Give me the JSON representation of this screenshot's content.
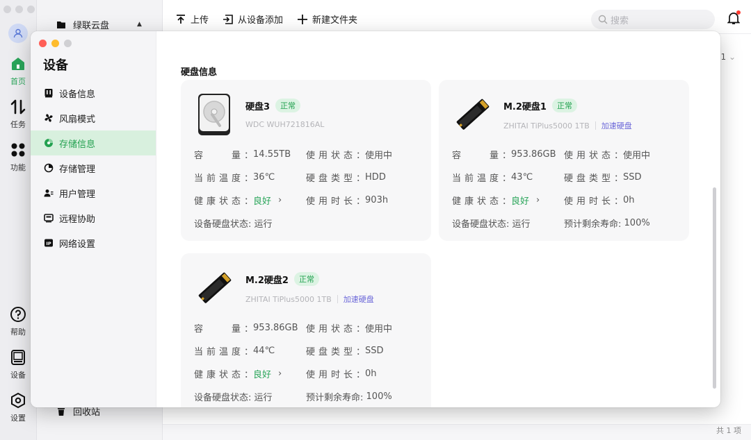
{
  "background": {
    "rail": {
      "items": [
        {
          "label": "首页",
          "icon": "home-icon",
          "active": true
        },
        {
          "label": "任务",
          "icon": "transfer-icon"
        },
        {
          "label": "功能",
          "icon": "apps-icon"
        },
        {
          "label": "帮助",
          "icon": "help-icon"
        },
        {
          "label": "设备",
          "icon": "device-icon"
        },
        {
          "label": "设置",
          "icon": "settings-icon"
        }
      ]
    },
    "sidebar": {
      "title": "绿联云盘",
      "trash": "回收站"
    },
    "toolbar": {
      "upload": "上传",
      "add_from_device": "从设备添加",
      "new_folder": "新建文件夹"
    },
    "search": {
      "placeholder": "搜索"
    },
    "partial_text": "1",
    "footer": "共 1 项"
  },
  "modal": {
    "title": "设备",
    "nav": [
      {
        "label": "设备信息",
        "icon": "device-info-icon"
      },
      {
        "label": "风扇模式",
        "icon": "fan-icon"
      },
      {
        "label": "存储信息",
        "icon": "storage-info-icon",
        "active": true
      },
      {
        "label": "存储管理",
        "icon": "storage-manage-icon"
      },
      {
        "label": "用户管理",
        "icon": "users-icon"
      },
      {
        "label": "远程协助",
        "icon": "remote-icon"
      },
      {
        "label": "网络设置",
        "icon": "network-icon"
      }
    ],
    "section_title": "硬盘信息",
    "disks": [
      {
        "name": "硬盘3",
        "status": "正常",
        "model": "WDC WUH721816AL",
        "accel": "",
        "icon": "hdd-icon",
        "capacity_label": "容　　量",
        "capacity": "14.55TB",
        "use_state_label": "使用状态",
        "use_state": "使用中",
        "temp_label": "当前温度",
        "temp": "36℃",
        "type_label": "硬盘类型",
        "type": "HDD",
        "health_label": "健康状态",
        "health": "良好",
        "hours_label": "使用时长",
        "hours": "903h",
        "run_label": "设备硬盘状态:",
        "run": "运行",
        "life_label": "",
        "life": ""
      },
      {
        "name": "M.2硬盘1",
        "status": "正常",
        "model": "ZHITAI TiPlus5000 1TB",
        "accel": "加速硬盘",
        "icon": "m2-ssd-icon",
        "capacity_label": "容　　量",
        "capacity": "953.86GB",
        "use_state_label": "使用状态",
        "use_state": "使用中",
        "temp_label": "当前温度",
        "temp": "43℃",
        "type_label": "硬盘类型",
        "type": "SSD",
        "health_label": "健康状态",
        "health": "良好",
        "hours_label": "使用时长",
        "hours": "0h",
        "run_label": "设备硬盘状态:",
        "run": "运行",
        "life_label": "预计剩余寿命:",
        "life": "100%"
      },
      {
        "name": "M.2硬盘2",
        "status": "正常",
        "model": "ZHITAI TiPlus5000 1TB",
        "accel": "加速硬盘",
        "icon": "m2-ssd-icon",
        "capacity_label": "容　　量",
        "capacity": "953.86GB",
        "use_state_label": "使用状态",
        "use_state": "使用中",
        "temp_label": "当前温度",
        "temp": "44℃",
        "type_label": "硬盘类型",
        "type": "SSD",
        "health_label": "健康状态",
        "health": "良好",
        "hours_label": "使用时长",
        "hours": "0h",
        "run_label": "设备硬盘状态:",
        "run": "运行",
        "life_label": "预计剩余寿命:",
        "life": "100%"
      }
    ]
  },
  "colors": {
    "accent": "#2aa55a",
    "active_bg": "#d8f0de",
    "link": "#6a66d8",
    "close": "#ff5f57",
    "minimize": "#febc2e",
    "zoom": "#d0d0d3"
  }
}
